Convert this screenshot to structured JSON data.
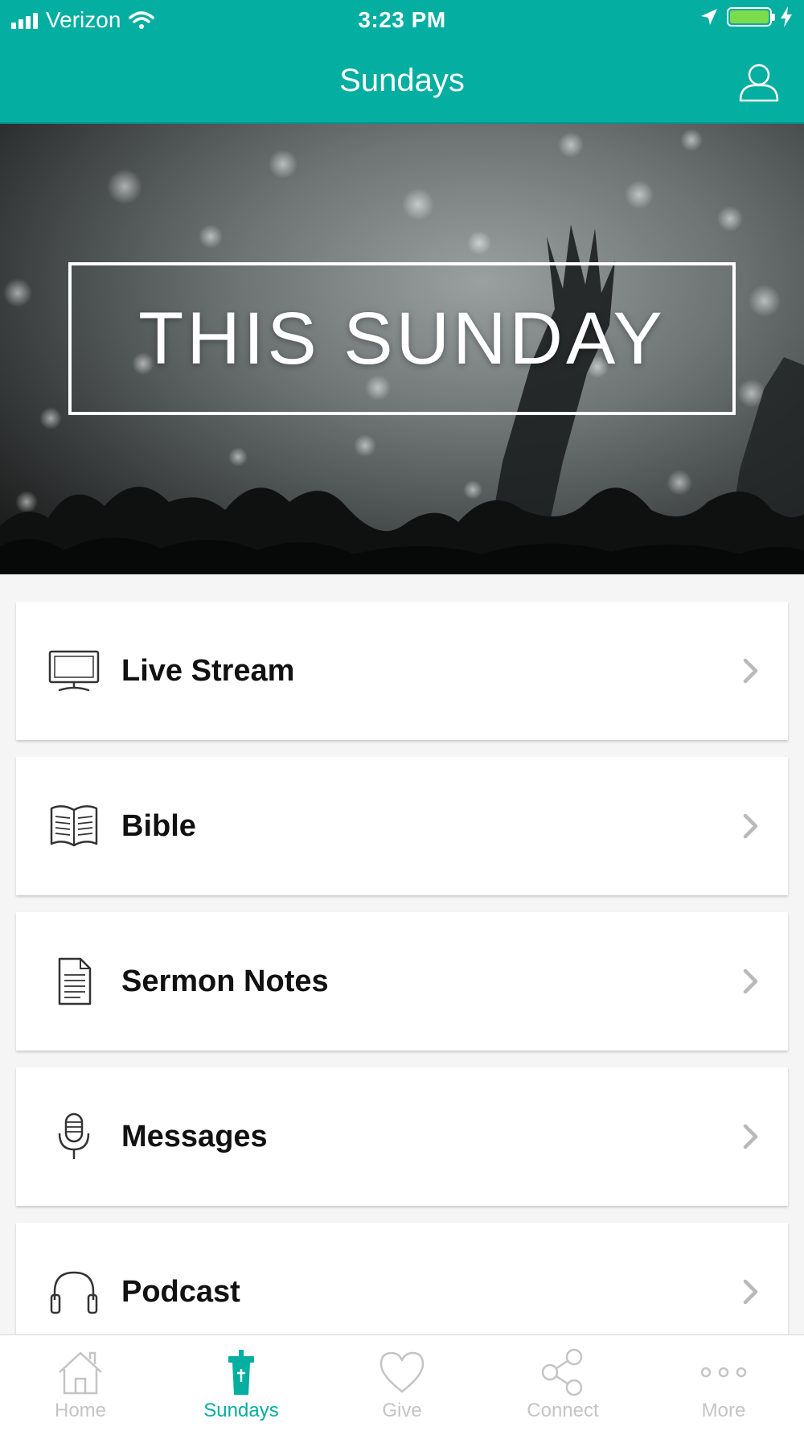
{
  "status_bar": {
    "carrier": "Verizon",
    "time": "3:23 PM"
  },
  "nav": {
    "title": "Sundays"
  },
  "hero": {
    "text": "THIS SUNDAY"
  },
  "menu_items": [
    {
      "label": "Live Stream",
      "icon": "monitor-icon"
    },
    {
      "label": "Bible",
      "icon": "open-book-icon"
    },
    {
      "label": "Sermon Notes",
      "icon": "document-icon"
    },
    {
      "label": "Messages",
      "icon": "microphone-icon"
    },
    {
      "label": "Podcast",
      "icon": "headphones-icon"
    }
  ],
  "tabs": [
    {
      "label": "Home",
      "icon": "home-icon"
    },
    {
      "label": "Sundays",
      "icon": "pulpit-icon",
      "active": true
    },
    {
      "label": "Give",
      "icon": "heart-icon"
    },
    {
      "label": "Connect",
      "icon": "share-icon"
    },
    {
      "label": "More",
      "icon": "more-dots-icon"
    }
  ],
  "colors": {
    "brand": "#04aea0",
    "tab_inactive": "#c4c4c4",
    "battery": "#7ddc4c"
  }
}
